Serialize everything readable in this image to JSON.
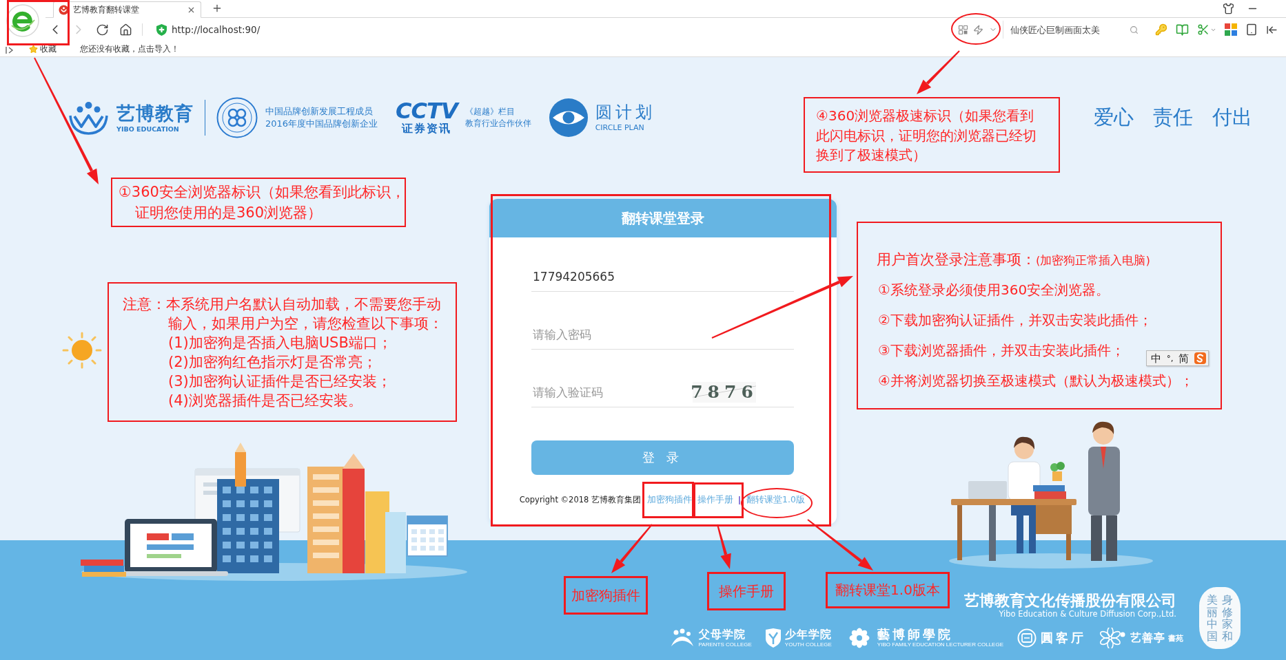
{
  "browser": {
    "tabs": [
      {
        "title": "艺博教育翻转课堂",
        "selected": true
      }
    ],
    "nav": [
      {
        "kind": "back",
        "disabled": false
      },
      {
        "kind": "forward",
        "disabled": true
      },
      {
        "kind": "reload",
        "disabled": false
      },
      {
        "kind": "home",
        "disabled": false
      }
    ],
    "address": {
      "url": "http://localhost:90/"
    },
    "search": {
      "placeholder": "仙侠匠心巨制画面太美"
    },
    "bookmarks": {
      "folder": "收藏",
      "hint": "您还没有收藏，点击导入！"
    }
  },
  "header": {
    "brand": {
      "name": "艺博教育",
      "tagline": "YIBO EDUCATION"
    },
    "partners": [
      {
        "kind": "emblem",
        "lines": [
          "中国品牌创新发展工程成员",
          "2016年度中国品牌创新企业"
        ]
      },
      {
        "kind": "cctv",
        "mark": "CCTV",
        "mark_sub": "证券资讯",
        "lines": [
          "《超越》栏目",
          "教育行业合作伙伴"
        ]
      },
      {
        "kind": "eye",
        "lines": [
          "圆计划",
          "CIRCLE PLAN"
        ]
      }
    ],
    "slogans": [
      "爱心",
      "责任",
      "付出"
    ]
  },
  "login": {
    "title": "翻转课堂登录",
    "fields": [
      {
        "kind": "account",
        "value": "17794205665"
      },
      {
        "kind": "password",
        "placeholder": "请输入密码"
      },
      {
        "kind": "captcha",
        "placeholder": "请输入验证码",
        "code": "7876"
      }
    ],
    "submit": "登 录",
    "copyright": "Copyright ©2018 艺博教育集团",
    "links": [
      "加密狗插件",
      "操作手册",
      "翻转课堂1.0版"
    ]
  },
  "footer": {
    "company": "艺博教育文化传播股份有限公司",
    "company_en": "Yibo Education & Culture Diffusion Corp.,Ltd.",
    "colleges": [
      {
        "kind": "parents",
        "name": "父母学院",
        "subtitle": "PARENTS COLLEGE"
      },
      {
        "kind": "youth",
        "name": "少年学院",
        "subtitle": "YOUTH COLLEGE"
      },
      {
        "kind": "lecturer",
        "name": "藝博師學院",
        "subtitle": "YIBO FAMILY EDUCATION LECTURER COLLEGE"
      },
      {
        "kind": "salon",
        "name": "圓客厅"
      },
      {
        "kind": "study",
        "name": "艺善亭",
        "subtitle": "書苑"
      }
    ],
    "seal": [
      "美丽中国",
      "身修家和"
    ]
  },
  "annotations": {
    "speed_note": [
      "④360浏览器极速标识（如果您看到",
      "此闪电标识，证明您的浏览器已经切",
      "换到了极速模式）"
    ],
    "browser_note": [
      "①360安全浏览器标识（如果您看到此标识，",
      "证明您使用的是360浏览器）"
    ],
    "username_note": {
      "lead": [
        "注意：本系统用户名默认自动加载，不需要您手动",
        "输入，如果用户为空，请您检查以下事项："
      ],
      "items": [
        "(1)加密狗是否插入电脑USB端口；",
        "(2)加密狗红色指示灯是否常亮；",
        "(3)加密狗认证插件是否已经安装；",
        "(4)浏览器插件是否已经安装。"
      ]
    },
    "first_login": {
      "title": "用户首次登录注意事项：",
      "subtitle": "(加密狗正常插入电脑)",
      "items": [
        "①系统登录必须使用360安全浏览器。",
        "②下载加密狗认证插件，并双击安装此插件；",
        "③下载浏览器插件，并双击安装此插件；",
        "④并将浏览器切换至极速模式（默认为极速模式）；"
      ]
    },
    "link_labels": [
      "加密狗插件",
      "操作手册",
      "翻转课堂1.0版本"
    ]
  },
  "ime": {
    "mode": "中",
    "punctuation": "°,",
    "script": "简"
  }
}
